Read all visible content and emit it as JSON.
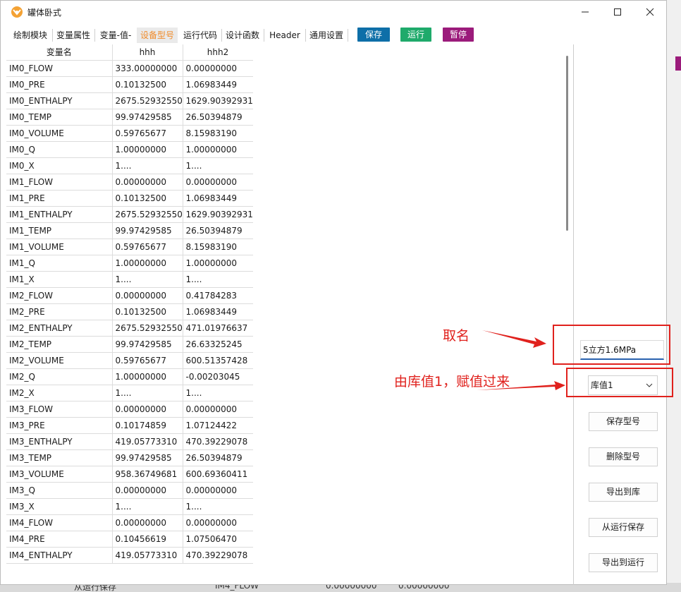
{
  "window": {
    "title": "罐体卧式"
  },
  "toolbar": {
    "tabs": [
      "绘制模块",
      "变量属性",
      "变量-值-",
      "设备型号",
      "运行代码",
      "设计函数",
      "Header",
      "通用设置"
    ],
    "active_tab": "设备型号",
    "buttons": [
      {
        "label": "保存",
        "color": "#0e6fa8"
      },
      {
        "label": "运行",
        "color": "#1faa6b"
      },
      {
        "label": "暂停",
        "color": "#9b1b7b"
      }
    ]
  },
  "table": {
    "headers": [
      "变量名",
      "hhh",
      "hhh2"
    ],
    "rows": [
      [
        "IM0_FLOW",
        "333.00000000",
        "0.00000000"
      ],
      [
        "IM0_PRE",
        "0.10132500",
        "1.06983449"
      ],
      [
        "IM0_ENTHALPY",
        "2675.52932550",
        "1629.90392931"
      ],
      [
        "IM0_TEMP",
        "99.97429585",
        "26.50394879"
      ],
      [
        "IM0_VOLUME",
        "0.59765677",
        "8.15983190"
      ],
      [
        "IM0_Q",
        "1.00000000",
        "1.00000000"
      ],
      [
        "IM0_X",
        "1....",
        "1...."
      ],
      [
        "IM1_FLOW",
        "0.00000000",
        "0.00000000"
      ],
      [
        "IM1_PRE",
        "0.10132500",
        "1.06983449"
      ],
      [
        "IM1_ENTHALPY",
        "2675.52932550",
        "1629.90392931"
      ],
      [
        "IM1_TEMP",
        "99.97429585",
        "26.50394879"
      ],
      [
        "IM1_VOLUME",
        "0.59765677",
        "8.15983190"
      ],
      [
        "IM1_Q",
        "1.00000000",
        "1.00000000"
      ],
      [
        "IM1_X",
        "1....",
        "1...."
      ],
      [
        "IM2_FLOW",
        "0.00000000",
        "0.41784283"
      ],
      [
        "IM2_PRE",
        "0.10132500",
        "1.06983449"
      ],
      [
        "IM2_ENTHALPY",
        "2675.52932550",
        "471.01976637"
      ],
      [
        "IM2_TEMP",
        "99.97429585",
        "26.63325245"
      ],
      [
        "IM2_VOLUME",
        "0.59765677",
        "600.51357428"
      ],
      [
        "IM2_Q",
        "1.00000000",
        "-0.00203045"
      ],
      [
        "IM2_X",
        "1....",
        "1...."
      ],
      [
        "IM3_FLOW",
        "0.00000000",
        "0.00000000"
      ],
      [
        "IM3_PRE",
        "0.10174859",
        "1.07124422"
      ],
      [
        "IM3_ENTHALPY",
        "419.05773310",
        "470.39229078"
      ],
      [
        "IM3_TEMP",
        "99.97429585",
        "26.50394879"
      ],
      [
        "IM3_VOLUME",
        "958.36749681",
        "600.69360411"
      ],
      [
        "IM3_Q",
        "0.00000000",
        "0.00000000"
      ],
      [
        "IM3_X",
        "1....",
        "1...."
      ],
      [
        "IM4_FLOW",
        "0.00000000",
        "0.00000000"
      ],
      [
        "IM4_PRE",
        "0.10456619",
        "1.07506470"
      ],
      [
        "IM4_ENTHALPY",
        "419.05773310",
        "470.39229078"
      ]
    ]
  },
  "panel": {
    "name_value": "5立方1.6MPa",
    "library_selected": "库值1",
    "buttons": [
      "保存型号",
      "删除型号",
      "导出到库",
      "从运行保存",
      "导出到运行"
    ]
  },
  "annotations": {
    "name_note": "取名",
    "library_note": "由库值1，赋值过来"
  },
  "background": {
    "bottom_texts": [
      "从运行保存",
      "IM4_FLOW",
      "0.00000000",
      "0.00000000"
    ]
  }
}
